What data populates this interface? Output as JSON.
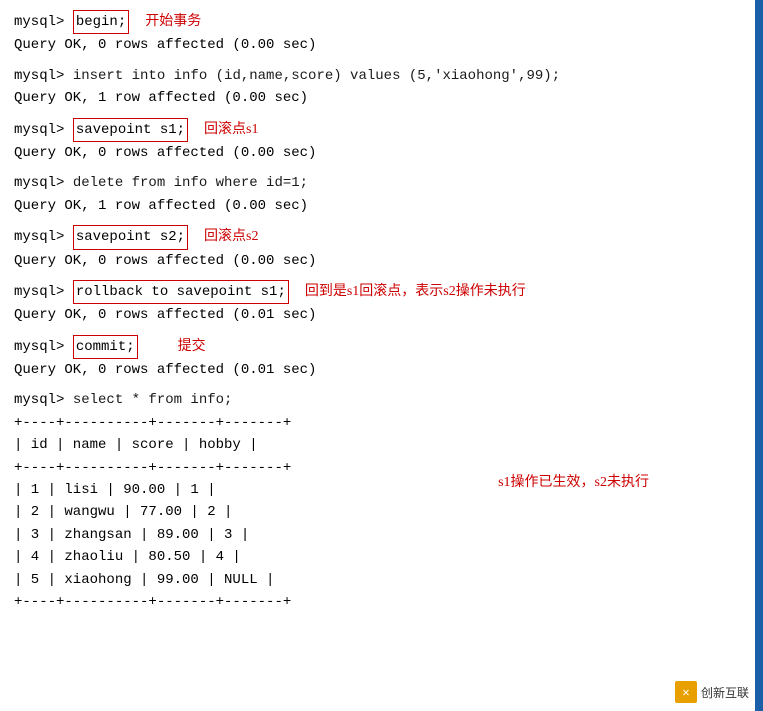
{
  "terminal": {
    "lines": [
      {
        "type": "command",
        "prompt": "mysql> ",
        "cmd": "begin;",
        "annotation": "开始事务"
      },
      {
        "type": "output",
        "text": "Query OK, 0 rows affected (0.00 sec)"
      },
      {
        "type": "blank"
      },
      {
        "type": "command-plain",
        "prompt": "mysql> ",
        "cmd": "insert into info (id,name,score) values (5,'xiaohong',99);"
      },
      {
        "type": "output",
        "text": "Query OK, 1 row affected (0.00 sec)"
      },
      {
        "type": "blank"
      },
      {
        "type": "command",
        "prompt": "mysql> ",
        "cmd": "savepoint s1;",
        "annotation": "回滚点s1"
      },
      {
        "type": "output",
        "text": "Query OK, 0 rows affected (0.00 sec)"
      },
      {
        "type": "blank"
      },
      {
        "type": "command-plain",
        "prompt": "mysql> ",
        "cmd": "delete from info where id=1;"
      },
      {
        "type": "output",
        "text": "Query OK, 1 row affected (0.00 sec)"
      },
      {
        "type": "blank"
      },
      {
        "type": "command",
        "prompt": "mysql> ",
        "cmd": "savepoint s2;",
        "annotation": "回滚点s2"
      },
      {
        "type": "output",
        "text": "Query OK, 0 rows affected (0.00 sec)"
      },
      {
        "type": "blank"
      },
      {
        "type": "command",
        "prompt": "mysql> ",
        "cmd": "rollback to savepoint s1;",
        "annotation": "回到是s1回滚点，表示s2操作未执行"
      },
      {
        "type": "output",
        "text": "Query OK, 0 rows affected (0.01 sec)"
      },
      {
        "type": "blank"
      },
      {
        "type": "command",
        "prompt": "mysql> ",
        "cmd": "commit;",
        "annotation": "提交"
      },
      {
        "type": "output",
        "text": "Query OK, 0 rows affected (0.01 sec)"
      },
      {
        "type": "blank"
      },
      {
        "type": "command-plain",
        "prompt": "mysql> ",
        "cmd": "select * from info;"
      }
    ],
    "table": {
      "separator": "+----+----------+-------+-------+",
      "header": "| id | name     | score | hobby |",
      "rows": [
        "| 1  | lisi     | 90.00 |     1 |",
        "| 2  | wangwu   | 77.00 |     2 |",
        "| 3  | zhangsan | 89.00 |     3 |",
        "| 4  | zhaoliu  | 80.50 |     4 |",
        "| 5  | xiaohong | 99.00 |  NULL |"
      ],
      "end_separator": "+----+----------+-------+-------+"
    },
    "table_annotation": "s1操作已生效，s2未执行",
    "watermark": {
      "icon": "✕",
      "text": "创新互联"
    }
  }
}
